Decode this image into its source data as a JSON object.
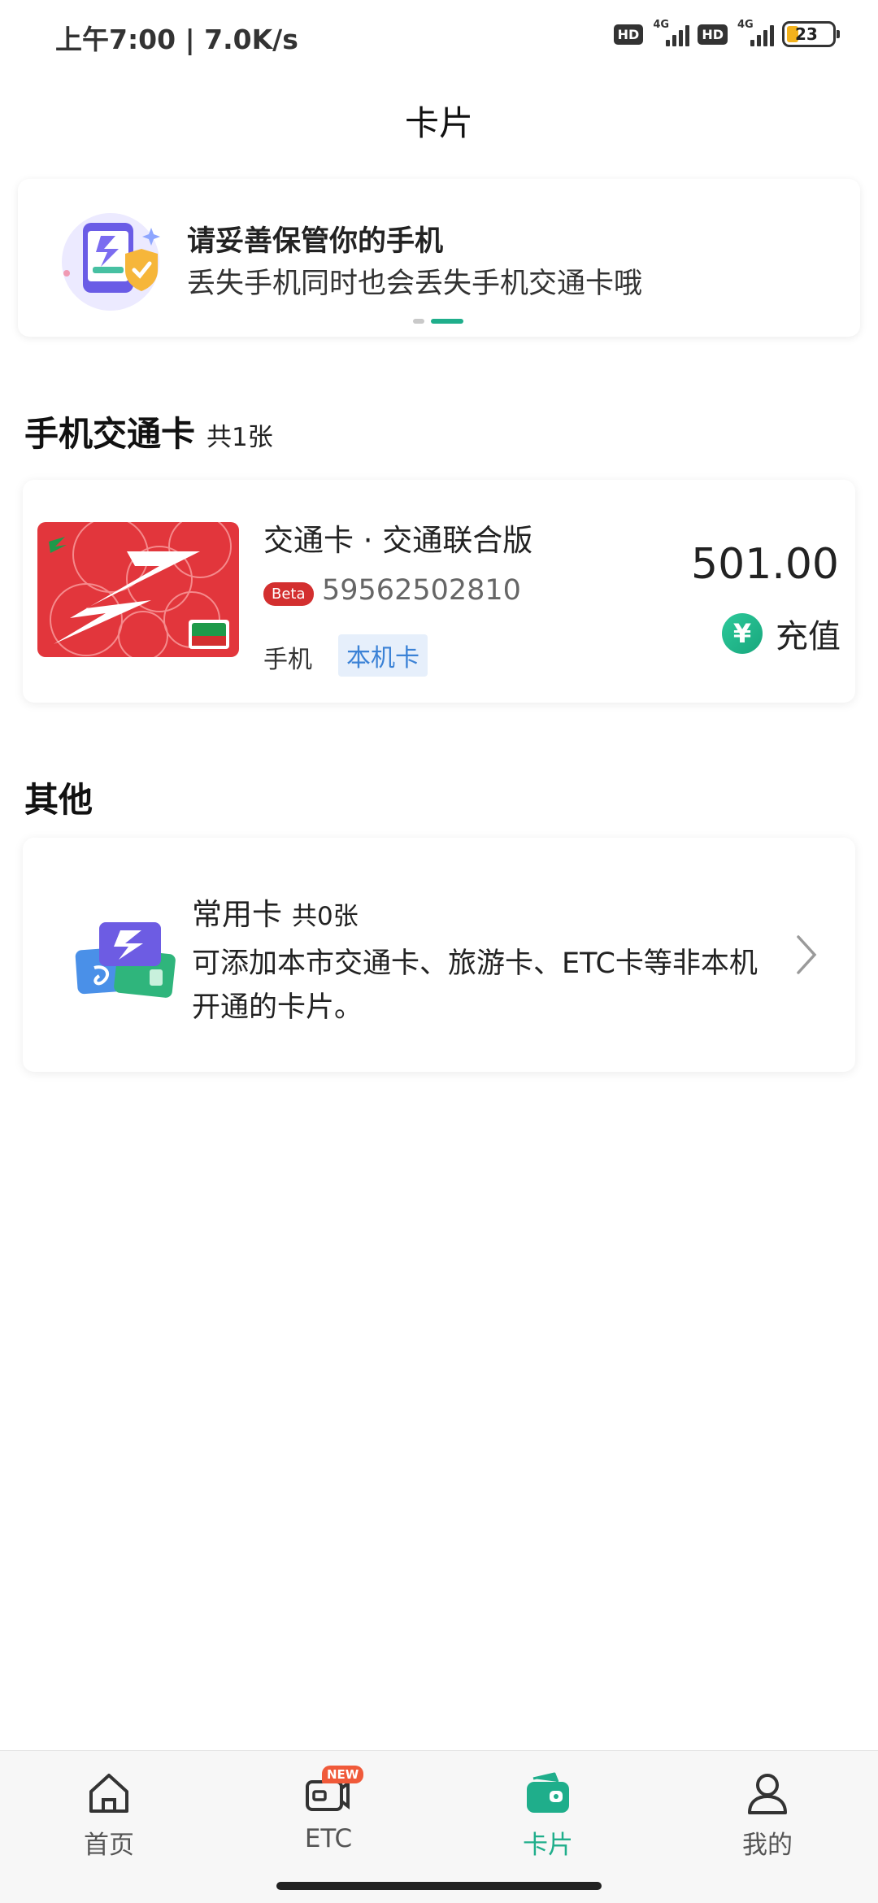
{
  "status_bar": {
    "time": "上午7:00 | 7.0K/s",
    "hd_label": "HD",
    "network_label": "4G",
    "battery": "23"
  },
  "page": {
    "title": "卡片"
  },
  "banner": {
    "title": "请妥善保管你的手机",
    "subtitle": "丢失手机同时也会丢失手机交通卡哦",
    "page_count": 2,
    "active_page": 2
  },
  "transit_section": {
    "title": "手机交通卡",
    "count": "共1张",
    "card": {
      "name": "交通卡 · 交通联合版",
      "badge": "Beta",
      "number": "59562502810",
      "device": "手机",
      "tag": "本机卡",
      "balance": "501.00",
      "recharge_icon": "¥",
      "recharge_label": "充值"
    }
  },
  "other_section": {
    "title": "其他",
    "common": {
      "title": "常用卡",
      "count": "共0张",
      "desc": "可添加本市交通卡、旅游卡、ETC卡等非本机开通的卡片。"
    }
  },
  "bottom_nav": {
    "new_badge": "NEW",
    "items": [
      {
        "label": "首页",
        "icon": "home-icon"
      },
      {
        "label": "ETC",
        "icon": "etc-icon"
      },
      {
        "label": "卡片",
        "icon": "wallet-icon"
      },
      {
        "label": "我的",
        "icon": "person-icon"
      }
    ],
    "active_index": 2
  },
  "colors": {
    "accent": "#1fae8b",
    "beta": "#d32f2f",
    "tag": "#3b82d6"
  }
}
